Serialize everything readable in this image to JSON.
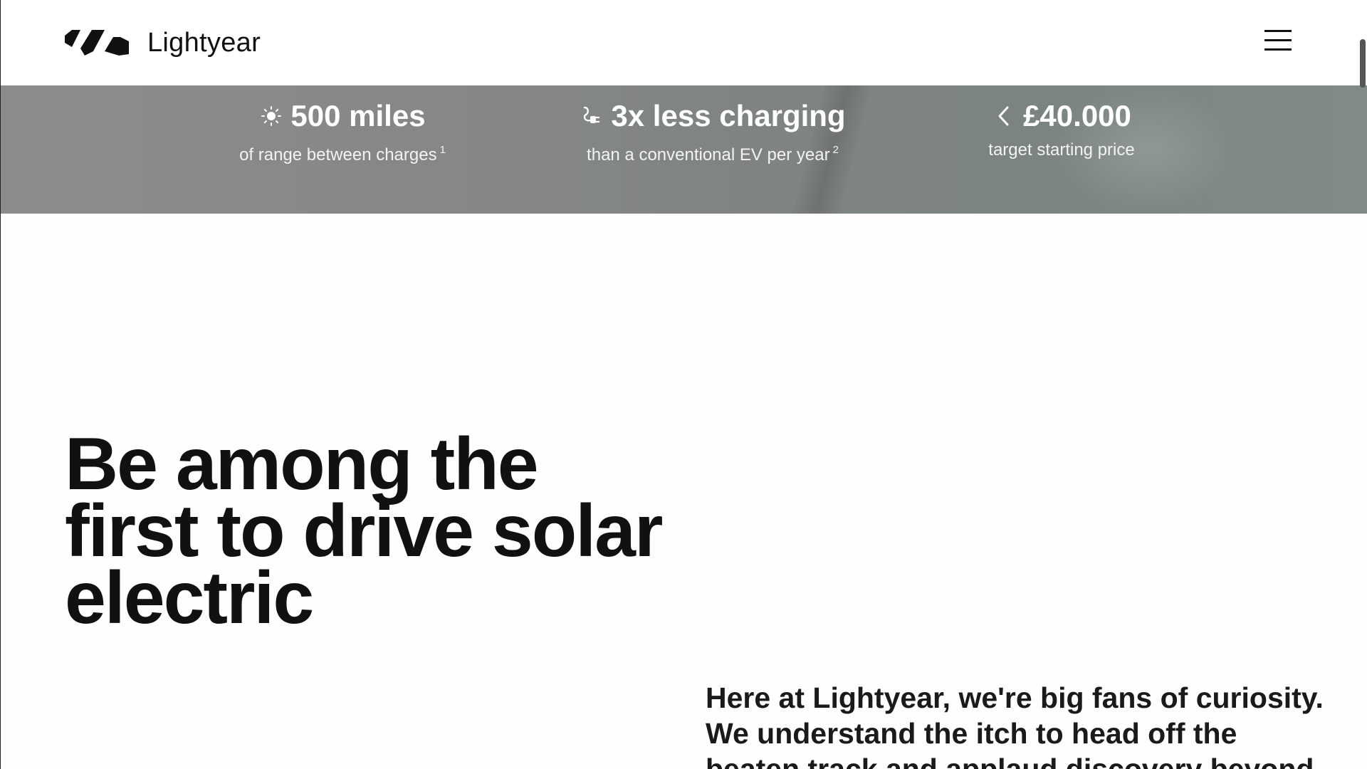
{
  "header": {
    "brand": "Lightyear",
    "logo_icon": "lightyear-stripes-logo",
    "menu_icon": "hamburger-menu-icon"
  },
  "stats": [
    {
      "icon": "sun-icon",
      "headline": "500 miles",
      "sub": "of range between charges",
      "footnote": "1"
    },
    {
      "icon": "plug-icon",
      "headline": "3x less charging",
      "sub": "than a conventional EV per year",
      "footnote": "2"
    },
    {
      "icon": "chevron-left-icon",
      "headline": "£40.000",
      "sub": "target starting price",
      "footnote": ""
    }
  ],
  "hero": {
    "line1": "Be among the",
    "line2": "first to drive solar",
    "line3": "electric"
  },
  "intro": {
    "text": "Here at Lightyear, we're big fans of curiosity. We understand the itch to head off the beaten track and applaud discovery beyond"
  },
  "colors": {
    "text": "#111111",
    "banner_bg": "#848886",
    "banner_text": "#ffffff",
    "page_bg": "#fefefe"
  }
}
